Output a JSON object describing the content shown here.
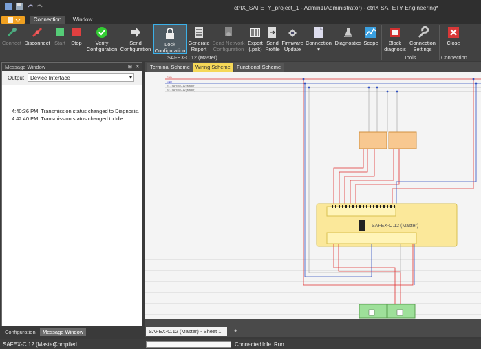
{
  "window": {
    "title": "ctrlX_SAFETY_project_1 - Admin1(Administrator) - ctrlX SAFETY Engineering*"
  },
  "menu_tabs": [
    "Connection",
    "Window"
  ],
  "ribbon": {
    "buttons": [
      {
        "id": "connect",
        "label": "Connect",
        "label2": "",
        "enabled": false
      },
      {
        "id": "disconnect",
        "label": "Disconnect",
        "label2": "",
        "enabled": true
      },
      {
        "id": "start",
        "label": "Start",
        "label2": "",
        "enabled": false
      },
      {
        "id": "stop",
        "label": "Stop",
        "label2": "",
        "enabled": true
      },
      {
        "id": "verify",
        "label": "Verify",
        "label2": "Configuration",
        "enabled": true
      },
      {
        "id": "send_config",
        "label": "Send",
        "label2": "Configuration",
        "enabled": true
      },
      {
        "id": "lock_config",
        "label": "Lock",
        "label2": "Configuration",
        "enabled": true
      },
      {
        "id": "gen_report",
        "label": "Generate",
        "label2": "Report",
        "enabled": true
      },
      {
        "id": "send_network",
        "label": "Send Network",
        "label2": "Configuration",
        "enabled": false
      },
      {
        "id": "export",
        "label": "Export",
        "label2": "(.pak)",
        "enabled": true
      },
      {
        "id": "send_profile",
        "label": "Send",
        "label2": "Profile",
        "enabled": true
      },
      {
        "id": "firmware",
        "label": "Firmware",
        "label2": "Update",
        "enabled": true
      },
      {
        "id": "connection",
        "label": "Connection",
        "label2": "",
        "enabled": true
      },
      {
        "id": "diagnostics",
        "label": "Diagnostics",
        "label2": "",
        "enabled": true
      },
      {
        "id": "scope",
        "label": "Scope",
        "label2": "",
        "enabled": true
      },
      {
        "id": "block_diag",
        "label": "Block",
        "label2": "diagnosis",
        "enabled": true
      },
      {
        "id": "conn_settings",
        "label": "Connection",
        "label2": "Settings",
        "enabled": true
      },
      {
        "id": "close",
        "label": "Close",
        "label2": "",
        "enabled": true
      }
    ],
    "group_labels": {
      "device": "SAFEX-C.12 (Master)",
      "tools": "Tools",
      "connection": "Connection"
    },
    "tooltip_lock": "Lock Configuration"
  },
  "message_window": {
    "title": "Message Window",
    "pin": "⊞",
    "close": "✕",
    "output_label": "Output",
    "output_value": "Device Interface",
    "messages": [
      {
        "time": "4:40:36 PM:",
        "text": "Transmission status changed to Diagnosis."
      },
      {
        "time": "4:42:40 PM:",
        "text": "Transmission status changed to Idle."
      }
    ]
  },
  "left_tabs": [
    "Configuration",
    "Message Window"
  ],
  "doc_tabs": [
    "Terminal Scheme",
    "Wiring Scheme",
    "Functional Scheme"
  ],
  "active_doc_tab": "Wiring Scheme",
  "schematic": {
    "wire_labels": [
      "GND",
      "GND",
      "R1 - SAFEX-C.12 (Master)",
      "R2 - SAFEX-C.12 (Master)"
    ],
    "main_module": "SAFEX-C.12 (Master)"
  },
  "sheet_tab": "SAFEX-C.12 (Master) - Sheet 1",
  "sheet_add": "+",
  "status": {
    "device": "SAFEX-C.12 (Master)",
    "state": "Compiled",
    "conn": "Connected",
    "mode": "Idle",
    "run": "Run"
  },
  "colors": {
    "accent": "#f0a020",
    "selected_tab": "#f5d858",
    "red_wire": "#e03030",
    "blue_wire": "#3050c0"
  }
}
